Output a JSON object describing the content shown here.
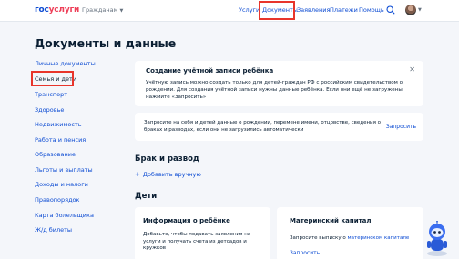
{
  "header": {
    "logo_part1": "гос",
    "logo_part2": "услуги",
    "citizens": "Гражданам",
    "nav": {
      "services": "Услуги",
      "documents": "Документы",
      "applications": "Заявления",
      "payments": "Платежи",
      "help": "Помощь"
    }
  },
  "page_title": "Документы и данные",
  "sidebar": [
    "Личные документы",
    "Семья и дети",
    "Транспорт",
    "Здоровье",
    "Недвижимость",
    "Работа и пенсия",
    "Образование",
    "Льготы и выплаты",
    "Доходы и налоги",
    "Правопорядок",
    "Карта болельщика",
    "Ж/д билеты"
  ],
  "notice": {
    "title": "Создание учётной записи ребёнка",
    "text": "Учётную запись можно создать только для детей-граждан РФ с российским свидетельством о рождении. Для создания учётной записи нужны данные ребёнка. Если они ещё не загружены, нажмите «Запросить»"
  },
  "request": {
    "text": "Запросите на себя и детей данные о рождении, перемене имени, отцовстве, сведения о браках и разводах, если они не загрузились автоматически",
    "link": "Запросить"
  },
  "marriage": {
    "title": "Брак и развод",
    "add": "Добавить вручную"
  },
  "children": {
    "title": "Дети",
    "child_card": {
      "title": "Информация о ребёнке",
      "text": "Добавьте, чтобы подавать заявления на услуги и получать счета из детсадов и кружков"
    },
    "capital_card": {
      "title": "Материнский капитал",
      "text_prefix": "Запросите выписку о ",
      "text_link": "материнском капитале",
      "link": "Запросить"
    }
  },
  "colors": {
    "brand_blue": "#0d4cd3",
    "brand_red": "#ee3f58",
    "highlight": "#e8352b"
  }
}
